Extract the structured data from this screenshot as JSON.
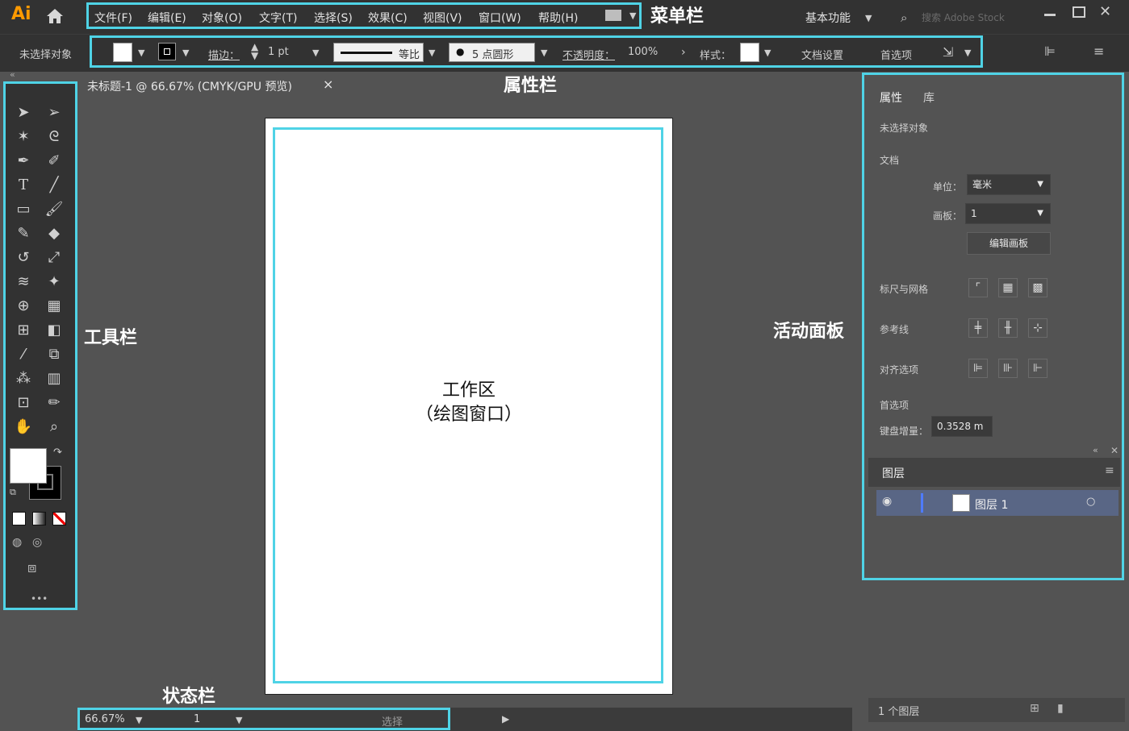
{
  "app": {
    "logo": "Ai",
    "workspace": "基本功能",
    "search_placeholder": "搜索 Adobe Stock"
  },
  "menu": [
    "文件(F)",
    "编辑(E)",
    "对象(O)",
    "文字(T)",
    "选择(S)",
    "效果(C)",
    "视图(V)",
    "窗口(W)",
    "帮助(H)"
  ],
  "propbar": {
    "selection": "未选择对象",
    "stroke_label": "描边：",
    "stroke_value": "1 pt",
    "stroke_style": "等比",
    "brush": "5 点圆形",
    "opacity_label": "不透明度：",
    "opacity_value": "100%",
    "style_label": "样式：",
    "doc_setup": "文档设置",
    "prefs": "首选项"
  },
  "doc_tab": {
    "title": "未标题-1 @ 66.67% (CMYK/GPU 预览)",
    "close": "×"
  },
  "annotations": {
    "menubar": "菜单栏",
    "propbar": "属性栏",
    "toolbar": "工具栏",
    "panel": "活动面板",
    "statusbar": "状态栏",
    "work_line1": "工作区",
    "work_line2": "（绘图窗口）"
  },
  "panel": {
    "tab_props": "属性",
    "tab_lib": "库",
    "no_selection": "未选择对象",
    "doc_section": "文档",
    "unit_label": "单位：",
    "unit_value": "毫米",
    "artboard_label": "画板：",
    "artboard_value": "1",
    "edit_artboard": "编辑画板",
    "rulers_grid": "标尺与网格",
    "guides": "参考线",
    "snap": "对齐选项",
    "prefs": "首选项",
    "keyboard_inc_label": "键盘增量：",
    "keyboard_inc_value": "0.3528 m"
  },
  "layers": {
    "title": "图层",
    "layer_name": "图层 1",
    "count": "1 个图层"
  },
  "status": {
    "zoom": "66.67%",
    "artboard": "1",
    "mode": "选择"
  },
  "colors": {
    "accent": "#4fd3e6",
    "logo": "#ff9a00",
    "chrome": "#323232",
    "canvas": "#535353"
  },
  "icons": {
    "tools": [
      "selection-tool-icon",
      "direct-selection-tool-icon",
      "magic-wand-tool-icon",
      "lasso-tool-icon",
      "pen-tool-icon",
      "curvature-tool-icon",
      "type-tool-icon",
      "line-segment-tool-icon",
      "rectangle-tool-icon",
      "paintbrush-tool-icon",
      "shaper-tool-icon",
      "eraser-tool-icon",
      "rotate-tool-icon",
      "scale-tool-icon",
      "width-tool-icon",
      "puppet-warp-tool-icon",
      "shape-builder-tool-icon",
      "perspective-grid-tool-icon",
      "mesh-tool-icon",
      "gradient-tool-icon",
      "eyedropper-tool-icon",
      "blend-tool-icon",
      "symbol-sprayer-tool-icon",
      "column-graph-tool-icon",
      "artboard-tool-icon",
      "slice-tool-icon",
      "hand-tool-icon",
      "zoom-tool-icon"
    ]
  }
}
